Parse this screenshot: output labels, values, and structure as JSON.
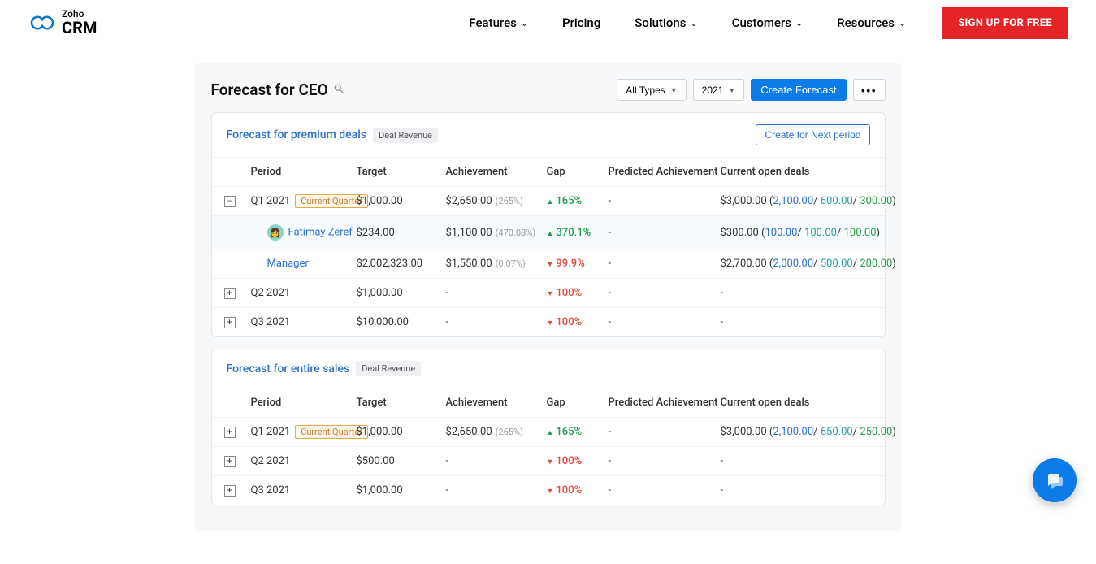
{
  "brand": {
    "zoho": "Zoho",
    "crm": "CRM"
  },
  "nav": {
    "features": "Features",
    "pricing": "Pricing",
    "solutions": "Solutions",
    "customers": "Customers",
    "resources": "Resources",
    "signup": "SIGN UP FOR FREE"
  },
  "page": {
    "title": "Forecast for CEO",
    "filter_type": "All Types",
    "filter_year": "2021",
    "create_forecast": "Create Forecast"
  },
  "columns": {
    "period": "Period",
    "target": "Target",
    "achievement": "Achievement",
    "gap": "Gap",
    "predicted": "Predicted Achievement",
    "open_deals": "Current open deals"
  },
  "card1": {
    "title": "Forecast for premium deals",
    "tag": "Deal Revenue",
    "cta": "Create for Next period",
    "rows": {
      "r0": {
        "period": "Q1 2021",
        "cq": "Current Quarter",
        "target": "$1,000.00",
        "ach": "$2,650.00",
        "ach_pct": "(265%)",
        "gap": "165%",
        "gap_dir": "up",
        "pred": "-",
        "deals_total": "$3,000.00",
        "deals_b": "2,100.00",
        "deals_t": "600.00",
        "deals_g": "300.00"
      },
      "r1": {
        "name": "Fatimay Zeref",
        "target": "$234.00",
        "ach": "$1,100.00",
        "ach_pct": "(470.08%)",
        "gap": "370.1%",
        "gap_dir": "up",
        "pred": "-",
        "deals_total": "$300.00",
        "deals_b": "100.00",
        "deals_t": "100.00",
        "deals_g": "100.00"
      },
      "r2": {
        "name": "Manager",
        "target": "$2,002,323.00",
        "ach": "$1,550.00",
        "ach_pct": "(0.07%)",
        "gap": "99.9%",
        "gap_dir": "down",
        "pred": "-",
        "deals_total": "$2,700.00",
        "deals_b": "2,000.00",
        "deals_t": "500.00",
        "deals_g": "200.00"
      },
      "r3": {
        "period": "Q2 2021",
        "target": "$1,000.00",
        "ach": "-",
        "gap": "100%",
        "gap_dir": "down",
        "pred": "-",
        "deals": "-"
      },
      "r4": {
        "period": "Q3 2021",
        "target": "$10,000.00",
        "ach": "-",
        "gap": "100%",
        "gap_dir": "down",
        "pred": "-",
        "deals": "-"
      }
    }
  },
  "card2": {
    "title": "Forecast for entire sales",
    "tag": "Deal Revenue",
    "rows": {
      "r0": {
        "period": "Q1 2021",
        "cq": "Current Quarter",
        "target": "$1,000.00",
        "ach": "$2,650.00",
        "ach_pct": "(265%)",
        "gap": "165%",
        "gap_dir": "up",
        "pred": "-",
        "deals_total": "$3,000.00",
        "deals_b": "2,100.00",
        "deals_t": "650.00",
        "deals_g": "250.00"
      },
      "r1": {
        "period": "Q2 2021",
        "target": "$500.00",
        "ach": "-",
        "gap": "100%",
        "gap_dir": "down",
        "pred": "-",
        "deals": "-"
      },
      "r2": {
        "period": "Q3 2021",
        "target": "$1,000.00",
        "ach": "-",
        "gap": "100%",
        "gap_dir": "down",
        "pred": "-",
        "deals": "-"
      }
    }
  }
}
